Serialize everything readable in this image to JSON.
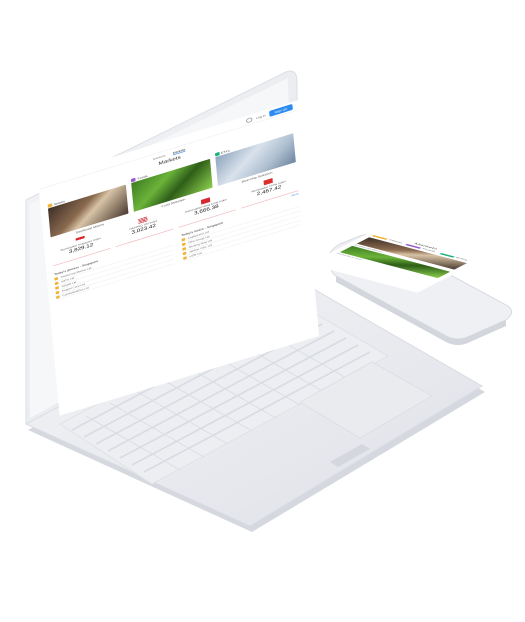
{
  "laptop": {
    "topbar": {
      "login": "Log in",
      "signup": "Sign Up"
    },
    "tabs": [
      "Markets",
      "Markets"
    ],
    "page_title": "Markets",
    "categories": [
      {
        "label": "Stocks",
        "color": "#f2b234",
        "caption": "Sembcorp Marine"
      },
      {
        "label": "Funds",
        "color": "#9b59d0",
        "caption": "Fund Selection"
      },
      {
        "label": "ETFs",
        "color": "#19b37a",
        "caption": "Blue-chip Selection"
      }
    ],
    "indices": [
      {
        "name": "Morningstar Singapore Index",
        "value": "3,829.12",
        "flag": "sg"
      },
      {
        "name": "NASDAQ 100 Index",
        "value": "3,023.42",
        "flag": "us"
      },
      {
        "name": "Morningstar Hong Kong Index",
        "value": "3,666.38",
        "flag": "hk"
      },
      {
        "name": "Morningstar China Index",
        "value": "2,467.42",
        "flag": "cn"
      }
    ],
    "movers": [
      {
        "heading": "Today's gainers - Singapore",
        "rows": [
          "SembCorp Marine Ltd",
          "SATS Ltd",
          "Singtel Ltd",
          "Keppel Corp Ltd",
          "ComfortDelGro Ltd"
        ]
      },
      {
        "heading": "Today's losers - Singapore",
        "rows": [
          "CapitaLand Ltd",
          "DBS Group Ltd",
          "Genting Sing Ltd",
          "Jardine C&C Ltd",
          "UOB Ltd"
        ]
      }
    ],
    "more": "More"
  },
  "phone": {
    "title": "Markets",
    "categories": [
      {
        "label": "Stocks",
        "color": "#f2b234"
      },
      {
        "label": "Funds",
        "color": "#9b59d0"
      },
      {
        "label": "ETFs",
        "color": "#19b37a"
      }
    ],
    "captions": [
      "Sembcorp Marine",
      "Fund Selection"
    ]
  }
}
